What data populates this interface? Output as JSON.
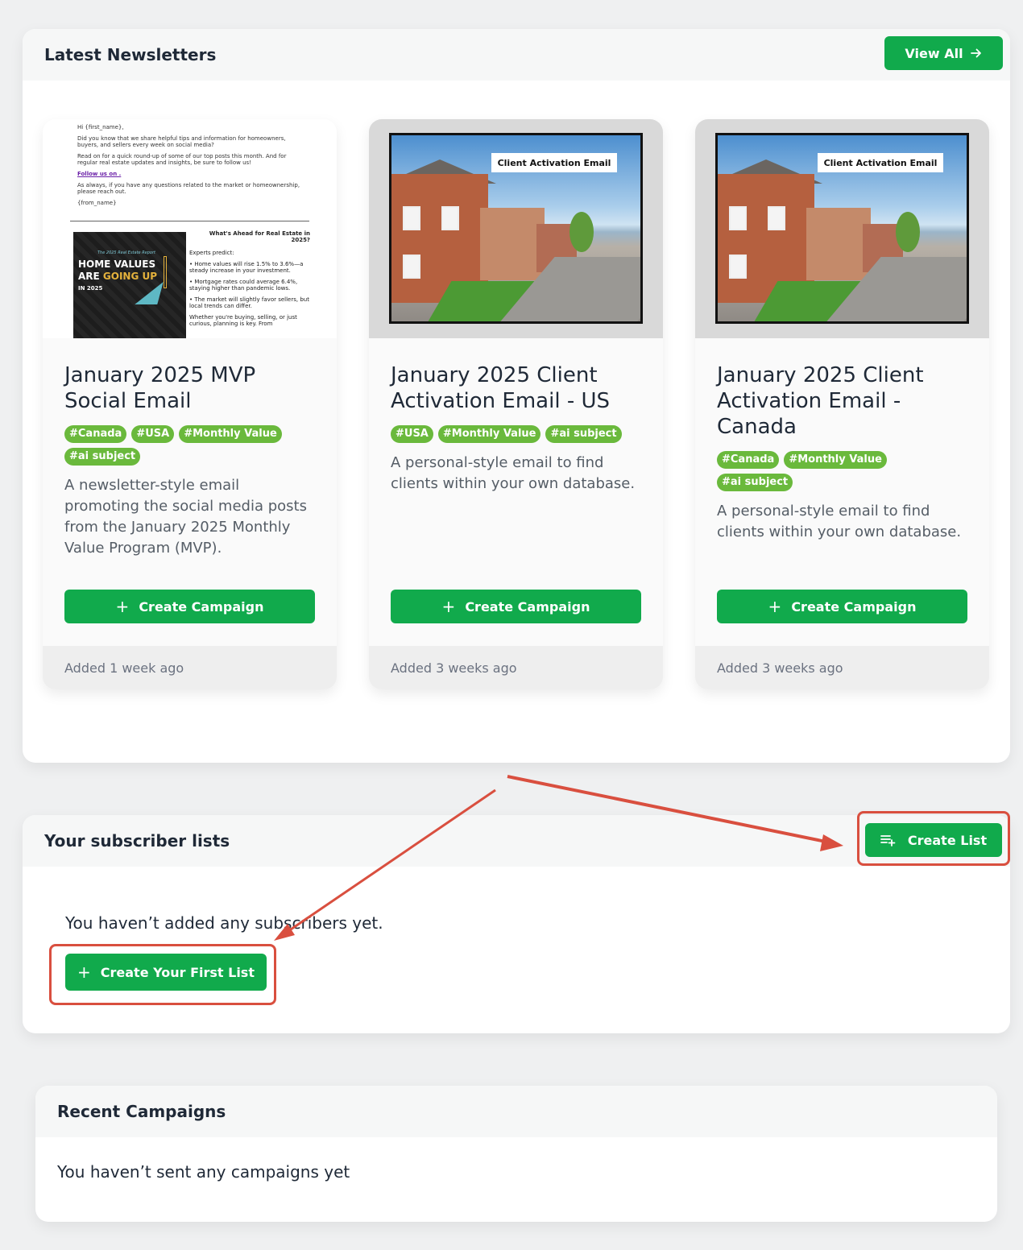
{
  "newsletters": {
    "title": "Latest Newsletters",
    "view_all_label": "View All",
    "cards": [
      {
        "title": "January 2025 MVP Social Email",
        "tags": [
          "#Canada",
          "#USA",
          "#Monthly Value",
          "#ai subject"
        ],
        "description": "A newsletter-style email promoting the social media posts from the January 2025 Monthly Value Program (MVP).",
        "button_label": "Create Campaign",
        "added": "Added 1 week ago",
        "thumbnail": {
          "greeting": "Hi {first_name},",
          "p1": "Did you know that we share helpful tips and information for homeowners, buyers, and sellers every week on social media?",
          "p2": "Read on for a quick round-up of some of our top posts this month. And for regular real estate updates and insights, be sure to follow us!",
          "link": "Follow us on .",
          "p3": "As always, if you have any questions related to the market or homeownership, please reach out.",
          "signoff": "{from_name}",
          "promo_sub": "The 2025 Real Estate Report",
          "promo_line1": "HOME VALUES",
          "promo_line2a": "ARE ",
          "promo_line2b": "GOING UP",
          "promo_year": "IN 2025",
          "side_heading": "What's Ahead for Real Estate in 2025?",
          "side_intro": "Experts predict:",
          "side_b1": "•  Home values will rise 1.5% to 3.6%—a steady increase in your investment.",
          "side_b2": "•  Mortgage rates could average 6.4%, staying higher than pandemic lows.",
          "side_b3": "•  The market will slightly favor sellers, but local trends can differ.",
          "side_end": "Whether you're buying, selling, or just curious, planning is key. From"
        }
      },
      {
        "title": "January 2025 Client Activation Email - US",
        "tags": [
          "#USA",
          "#Monthly Value",
          "#ai subject"
        ],
        "description": "A personal-style email to find clients within your own database.",
        "button_label": "Create Campaign",
        "added": "Added 3 weeks ago",
        "photo_label": "Client Activation Email"
      },
      {
        "title": "January 2025 Client Activation Email - Canada",
        "tags": [
          "#Canada",
          "#Monthly Value",
          "#ai subject"
        ],
        "description": "A personal-style email to find clients within your own database.",
        "button_label": "Create Campaign",
        "added": "Added 3 weeks ago",
        "photo_label": "Client Activation Email"
      }
    ]
  },
  "subscribers": {
    "title": "Your subscriber lists",
    "create_list_label": "Create List",
    "empty_text": "You haven’t added any subscribers yet.",
    "first_list_label": "Create Your First List"
  },
  "campaigns": {
    "title": "Recent Campaigns",
    "empty_text": "You haven’t sent any campaigns yet"
  },
  "icons": {
    "arrow_right": "arrow-right-icon",
    "plus": "plus-icon",
    "playlist_add": "playlist-add-icon"
  },
  "colors": {
    "accent_green": "#11aa4c",
    "tag_green": "#6ab93c",
    "annotation_red": "#d94f3f"
  }
}
